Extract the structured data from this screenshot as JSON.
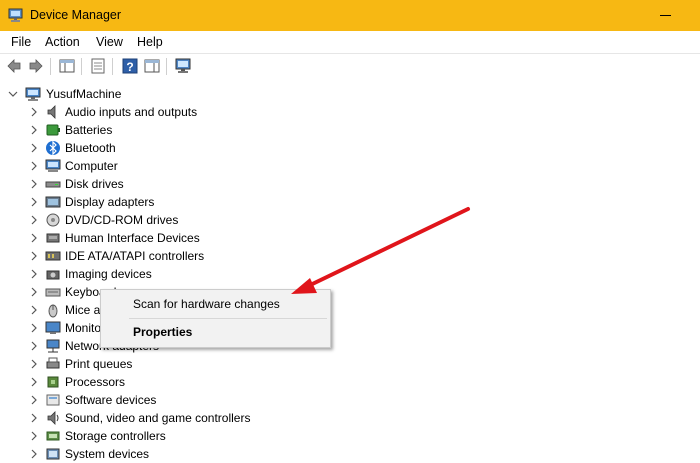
{
  "window": {
    "title": "Device Manager"
  },
  "menu": [
    "File",
    "Action",
    "View",
    "Help"
  ],
  "toolbar": [
    "back-icon",
    "forward-icon",
    "console-tree-icon",
    "properties-icon",
    "help-icon",
    "action-pane-icon",
    "scan-hardware-icon"
  ],
  "tree": {
    "root": "YusufMachine",
    "items": [
      {
        "label": "Audio inputs and outputs",
        "icon": "speaker-icon"
      },
      {
        "label": "Batteries",
        "icon": "battery-icon"
      },
      {
        "label": "Bluetooth",
        "icon": "bluetooth-icon"
      },
      {
        "label": "Computer",
        "icon": "computer-icon"
      },
      {
        "label": "Disk drives",
        "icon": "disk-drive-icon"
      },
      {
        "label": "Display adapters",
        "icon": "display-adapter-icon"
      },
      {
        "label": "DVD/CD-ROM drives",
        "icon": "dvd-drive-icon"
      },
      {
        "label": "Human Interface Devices",
        "icon": "hid-icon"
      },
      {
        "label": "IDE ATA/ATAPI controllers",
        "icon": "ide-controller-icon"
      },
      {
        "label": "Imaging devices",
        "icon": "camera-icon"
      },
      {
        "label": "Keyboards",
        "icon": "keyboard-icon"
      },
      {
        "label": "Mice and other pointing devices",
        "icon": "mouse-icon"
      },
      {
        "label": "Monitors",
        "icon": "monitor-icon"
      },
      {
        "label": "Network adapters",
        "icon": "network-adapter-icon"
      },
      {
        "label": "Print queues",
        "icon": "printer-icon"
      },
      {
        "label": "Processors",
        "icon": "processor-icon"
      },
      {
        "label": "Software devices",
        "icon": "software-device-icon"
      },
      {
        "label": "Sound, video and game controllers",
        "icon": "sound-controller-icon"
      },
      {
        "label": "Storage controllers",
        "icon": "storage-controller-icon"
      },
      {
        "label": "System devices",
        "icon": "system-device-icon"
      }
    ]
  },
  "context_menu": {
    "scan": "Scan for hardware changes",
    "properties": "Properties"
  },
  "colors": {
    "titlebar": "#f7b813",
    "arrow": "#e0151b"
  }
}
